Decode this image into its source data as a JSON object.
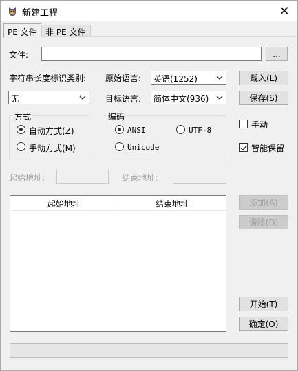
{
  "window": {
    "title": "新建工程",
    "close_glyph": "✕"
  },
  "tabs": [
    {
      "label": "PE 文件"
    },
    {
      "label": "非 PE 文件"
    }
  ],
  "file": {
    "label": "文件:",
    "value": "",
    "browse_label": "..."
  },
  "string_length_type": {
    "label": "字符串长度标识类别:",
    "selected": "无"
  },
  "source_lang": {
    "label": "原始语言:",
    "selected": "英语(1252)"
  },
  "target_lang": {
    "label": "目标语言:",
    "selected": "简体中文(936)"
  },
  "buttons": {
    "load": "载入(L)",
    "save": "保存(S)",
    "add": "添加(A)",
    "clear": "清除(D)",
    "start": "开始(T)",
    "ok": "确定(O)"
  },
  "mode_group": {
    "title": "方式",
    "options": [
      {
        "label": "自动方式(Z)",
        "checked": true
      },
      {
        "label": "手动方式(M)",
        "checked": false
      }
    ]
  },
  "encoding_group": {
    "title": "编码",
    "options": [
      {
        "label": "ANSI",
        "checked": true
      },
      {
        "label": "UTF-8",
        "checked": false
      },
      {
        "label": "Unicode",
        "checked": false
      }
    ]
  },
  "checkboxes": [
    {
      "label": "手动",
      "checked": false
    },
    {
      "label": "智能保留",
      "checked": true
    }
  ],
  "address": {
    "start_label": "起始地址:",
    "end_label": "结束地址:",
    "start_value": "",
    "end_value": ""
  },
  "table": {
    "columns": [
      "起始地址",
      "结束地址"
    ],
    "rows": []
  }
}
